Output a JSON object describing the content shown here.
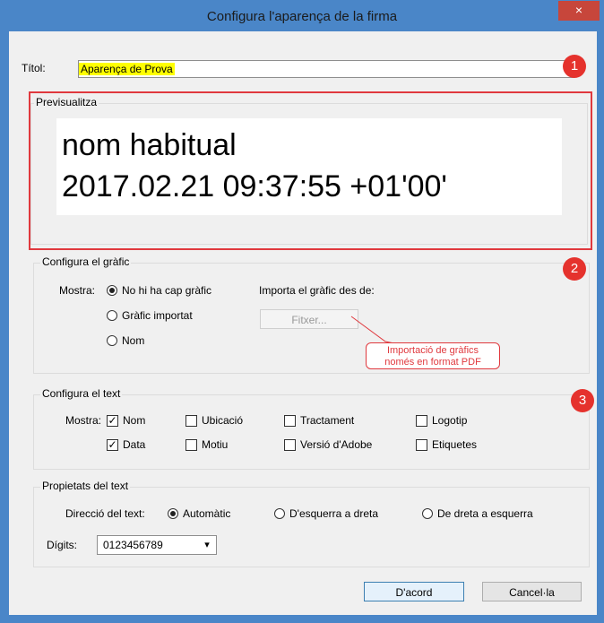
{
  "window": {
    "title": "Configura l'aparença de la firma",
    "close_glyph": "×"
  },
  "title_field": {
    "label": "Títol:",
    "value": "Aparença de Prova"
  },
  "preview": {
    "group_label": "Previsualitza",
    "line1": "nom habitual",
    "line2": "2017.02.21 09:37:55 +01'00'"
  },
  "graphic": {
    "group_label": "Configura el gràfic",
    "show_label": "Mostra:",
    "options": [
      "No hi ha cap gràfic",
      "Gràfic importat",
      "Nom"
    ],
    "selected_index": 0,
    "import_label": "Importa el gràfic des de:",
    "file_button": "Fitxer...",
    "callout_line1": "Importació de gràfics",
    "callout_line2": "només en format PDF"
  },
  "text_config": {
    "group_label": "Configura el text",
    "show_label": "Mostra:",
    "checkboxes": [
      {
        "label": "Nom",
        "checked": true
      },
      {
        "label": "Ubicació",
        "checked": false
      },
      {
        "label": "Tractament",
        "checked": false
      },
      {
        "label": "Logotip",
        "checked": false
      },
      {
        "label": "Data",
        "checked": true
      },
      {
        "label": "Motiu",
        "checked": false
      },
      {
        "label": "Versió d'Adobe",
        "checked": false
      },
      {
        "label": "Etiquetes",
        "checked": false
      }
    ]
  },
  "text_props": {
    "group_label": "Propietats del text",
    "direction_label": "Direcció del text:",
    "direction_options": [
      "Automàtic",
      "D'esquerra a dreta",
      "De dreta a esquerra"
    ],
    "direction_selected": 0,
    "digits_label": "Dígits:",
    "digits_value": "0123456789"
  },
  "badges": [
    "1",
    "2",
    "3"
  ],
  "buttons": {
    "ok": "D'acord",
    "cancel": "Cancel·la"
  },
  "colors": {
    "titlebar": "#4a86c8",
    "close": "#c7463b",
    "highlight": "#ffff00",
    "accent_red": "#e0393e"
  }
}
